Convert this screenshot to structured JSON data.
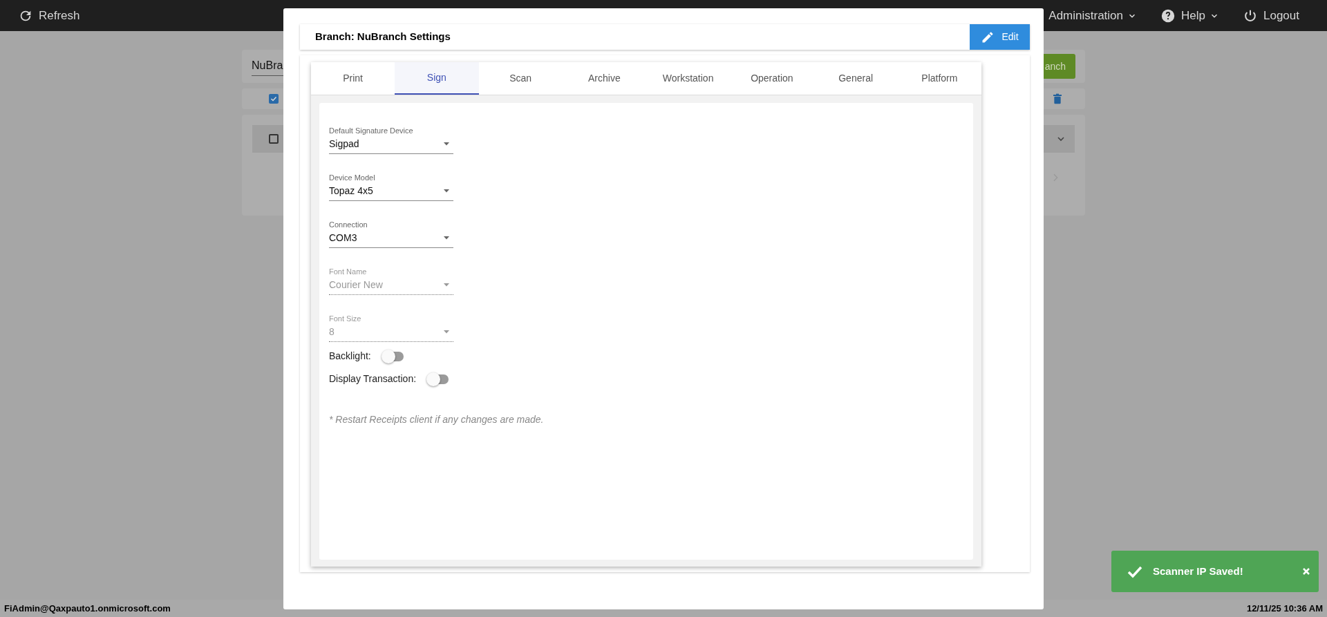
{
  "top_bar": {
    "items": [
      {
        "kind": "refresh",
        "label": "Refresh"
      },
      {
        "kind": "menu",
        "label": "Administration"
      },
      {
        "kind": "help",
        "label": "Help"
      },
      {
        "kind": "logout",
        "label": "Logout"
      }
    ]
  },
  "background_page": {
    "branch_field": {
      "value": "NuBra"
    },
    "add_button": "anch",
    "select_all": {
      "checked": true
    },
    "row": {
      "checked": false
    }
  },
  "dialog": {
    "title": "Branch: NuBranch Settings",
    "edit_button": "Edit",
    "tabs": [
      {
        "label": "Print",
        "selected": false
      },
      {
        "label": "Sign",
        "selected": true
      },
      {
        "label": "Scan",
        "selected": false
      },
      {
        "label": "Archive",
        "selected": false
      },
      {
        "label": "Workstation",
        "selected": false
      },
      {
        "label": "Operation",
        "selected": false
      },
      {
        "label": "General",
        "selected": false
      },
      {
        "label": "Platform",
        "selected": false
      }
    ],
    "fields": [
      {
        "label": "Default Signature Device",
        "value": "Sigpad",
        "disabled": false
      },
      {
        "label": "Device Model",
        "value": "Topaz 4x5",
        "disabled": false
      },
      {
        "label": "Connection",
        "value": "COM3",
        "disabled": false
      },
      {
        "label": "Font Name",
        "value": "Courier New",
        "disabled": true
      },
      {
        "label": "Font Size",
        "value": "8",
        "disabled": true
      }
    ],
    "toggles": [
      {
        "label": "Backlight:",
        "on": false
      },
      {
        "label": "Display Transaction:",
        "on": false
      }
    ],
    "note": "* Restart Receipts client if any changes are made."
  },
  "status_bar": {
    "user": "FiAdmin@Qaxpauto1.onmicrosoft.com",
    "datetime": "12/11/25 10:36 AM"
  },
  "toast": {
    "message": "Scanner IP Saved!"
  }
}
